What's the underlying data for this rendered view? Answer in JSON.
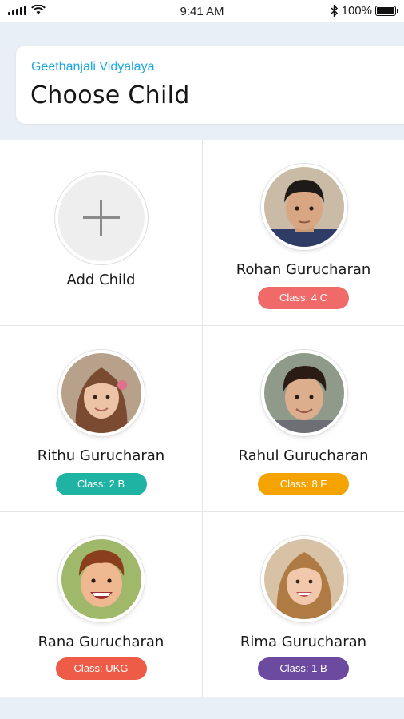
{
  "status_bar": {
    "time": "9:41 AM",
    "battery_text": "100%",
    "bluetooth_icon": "✱"
  },
  "header": {
    "school_name": "Geethanjali Vidyalaya",
    "title": "Choose Child"
  },
  "add_child": {
    "label": "Add Child"
  },
  "children": [
    {
      "name": "Rohan Gurucharan",
      "class_label": "Class: 4 C",
      "pill_color": "#f06a6a"
    },
    {
      "name": "Rithu Gurucharan",
      "class_label": "Class: 2 B",
      "pill_color": "#1fb3a3"
    },
    {
      "name": "Rahul Gurucharan",
      "class_label": "Class: 8 F",
      "pill_color": "#f5a300"
    },
    {
      "name": "Rana Gurucharan",
      "class_label": "Class: UKG",
      "pill_color": "#ee5c48"
    },
    {
      "name": "Rima Gurucharan",
      "class_label": "Class: 1 B",
      "pill_color": "#6c4aa0"
    }
  ],
  "colors": {
    "accent": "#1aa8de",
    "background": "#e9eff6"
  }
}
